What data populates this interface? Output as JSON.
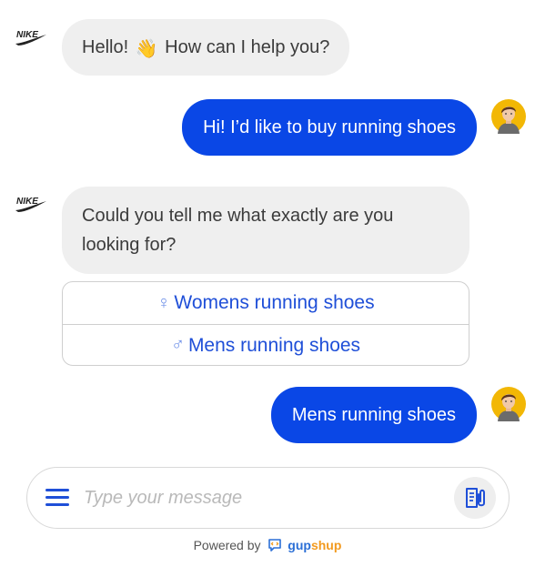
{
  "bot": {
    "logo_text": "NIKE"
  },
  "messages": [
    {
      "from": "bot",
      "text_before": "Hello!",
      "emoji": "👋",
      "text_after": "How can I help you?"
    },
    {
      "from": "user",
      "text": "Hi! I’d like to buy running shoes"
    },
    {
      "from": "bot",
      "text": "Could you tell me what exactly are you looking for?"
    },
    {
      "from": "user",
      "text": "Mens running shoes"
    }
  ],
  "quick_replies": [
    {
      "symbol": "♀",
      "label": "Womens running shoes"
    },
    {
      "symbol": "♂",
      "label": "Mens running shoes"
    }
  ],
  "composer": {
    "placeholder": "Type your message"
  },
  "footer": {
    "powered_by": "Powered by",
    "brand_a": "gup",
    "brand_b": "shup"
  },
  "colors": {
    "user_bubble": "#0a47e6",
    "bot_bubble": "#efefef",
    "accent": "#1f4fd8"
  },
  "icons": {
    "menu": "hamburger-icon",
    "attach": "attachment-icon",
    "avatar": "user-avatar",
    "logo": "nike-logo"
  }
}
